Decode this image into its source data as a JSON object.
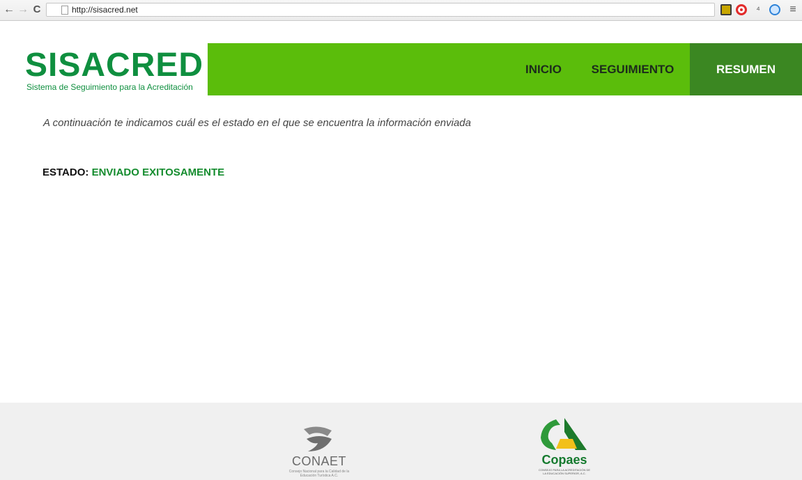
{
  "browser": {
    "url": "http://sisacred.net",
    "back_glyph": "←",
    "forward_glyph": "→",
    "reload_glyph": "C",
    "menu_glyph": "≡",
    "extension_glyph": "⁴"
  },
  "header": {
    "logo_title": "SISACRED",
    "logo_subtitle": "Sistema de Seguimiento para la Acreditación",
    "nav": {
      "inicio": "INICIO",
      "seguimiento": "SEGUIMIENTO",
      "resumen": "RESUMEN"
    }
  },
  "main": {
    "intro": "A continuación te indicamos cuál es el estado en el que se encuentra la información enviada",
    "status_label": "ESTADO:",
    "status_value": "ENVIADO EXITOSAMENTE"
  },
  "footer": {
    "conaet_name": "CONAET",
    "conaet_sub": "Consejo Nacional para la Calidad de la Educación Turística A.C.",
    "copaes_name": "Copaes",
    "copaes_sub": "CONSEJO PARA LA ACREDITACIÓN DE LA EDUCACIÓN SUPERIOR, A.C."
  },
  "colors": {
    "brand_green": "#0f8f3f",
    "nav_green": "#5bbd0b",
    "nav_active": "#3b8722",
    "status_green": "#148c2e"
  }
}
